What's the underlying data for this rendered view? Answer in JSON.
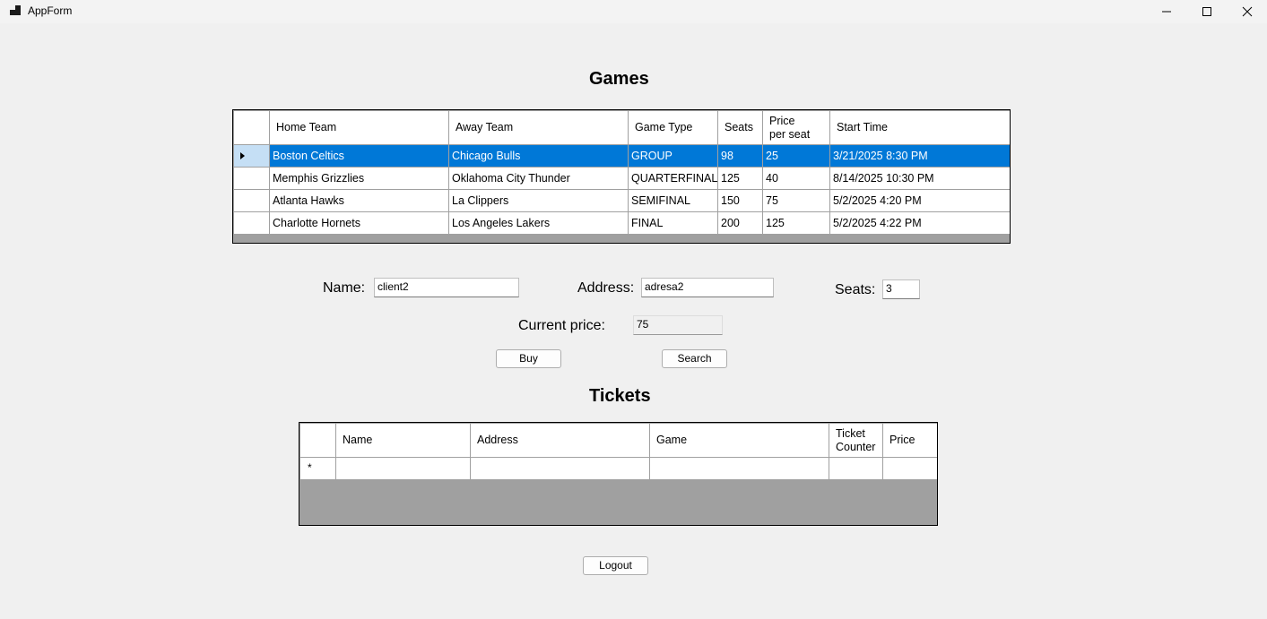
{
  "window": {
    "title": "AppForm"
  },
  "games": {
    "heading": "Games",
    "columns": [
      "Home Team",
      "Away Team",
      "Game Type",
      "Seats",
      "Price per seat",
      "Start Time"
    ],
    "column_lines": {
      "price_line1": "Price",
      "price_line2": "per seat"
    },
    "rows": [
      {
        "home": "Boston Celtics",
        "away": "Chicago Bulls",
        "type": "GROUP",
        "seats": "98",
        "price": "25",
        "start": "3/21/2025 8:30 PM"
      },
      {
        "home": "Memphis Grizzlies",
        "away": "Oklahoma City Thunder",
        "type": "QUARTERFINAL",
        "seats": "125",
        "price": "40",
        "start": "8/14/2025 10:30 PM"
      },
      {
        "home": "Atlanta Hawks",
        "away": "La Clippers",
        "type": "SEMIFINAL",
        "seats": "150",
        "price": "75",
        "start": "5/2/2025 4:20 PM"
      },
      {
        "home": "Charlotte Hornets",
        "away": "Los Angeles Lakers",
        "type": "FINAL",
        "seats": "200",
        "price": "125",
        "start": "5/2/2025 4:22 PM"
      }
    ],
    "selected_row": 0
  },
  "form": {
    "name_label": "Name:",
    "name_value": "client2",
    "address_label": "Address:",
    "address_value": "adresa2",
    "seats_label": "Seats:",
    "seats_value": "3",
    "price_label": "Current price:",
    "price_value": "75",
    "buy_label": "Buy",
    "search_label": "Search"
  },
  "tickets": {
    "heading": "Tickets",
    "columns": [
      "Name",
      "Address",
      "Game",
      "Ticket Counter",
      "Price"
    ],
    "column_lines": {
      "counter_line1": "Ticket",
      "counter_line2": "Counter"
    },
    "new_row_marker": "*"
  },
  "logout_label": "Logout",
  "colors": {
    "selection": "#0078d7",
    "selection_header": "#c5dff5",
    "grid_background": "#a0a0a0"
  }
}
